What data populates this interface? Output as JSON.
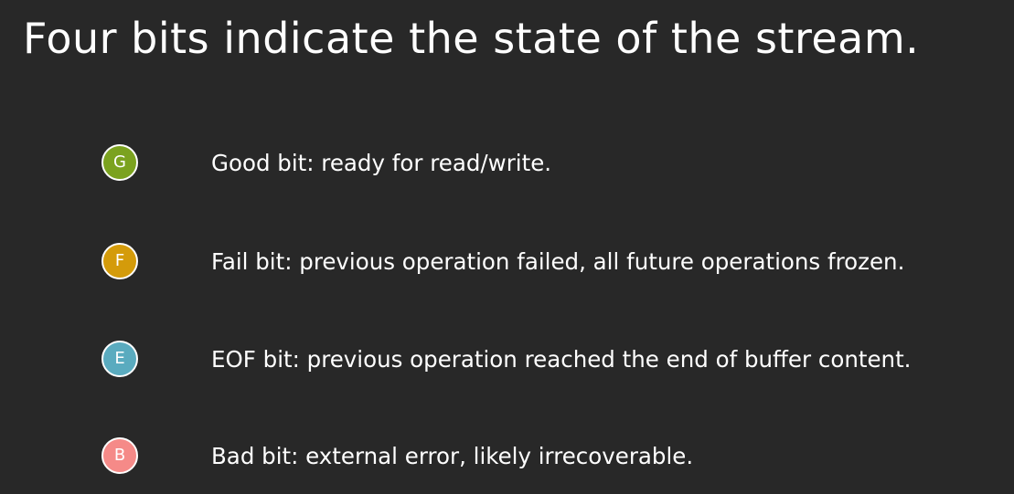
{
  "slide": {
    "title": "Four bits indicate the state of the stream."
  },
  "bits": [
    {
      "letter": "G",
      "color": "#7ba21f",
      "text": "Good bit: ready for read/write."
    },
    {
      "letter": "F",
      "color": "#d49b0a",
      "text": "Fail bit: previous operation failed, all future operations frozen."
    },
    {
      "letter": "E",
      "color": "#5aabbf",
      "text": "EOF bit: previous operation reached the end of buffer content."
    },
    {
      "letter": "B",
      "color": "#f58a88",
      "text": "Bad bit: external error, likely irrecoverable."
    }
  ]
}
